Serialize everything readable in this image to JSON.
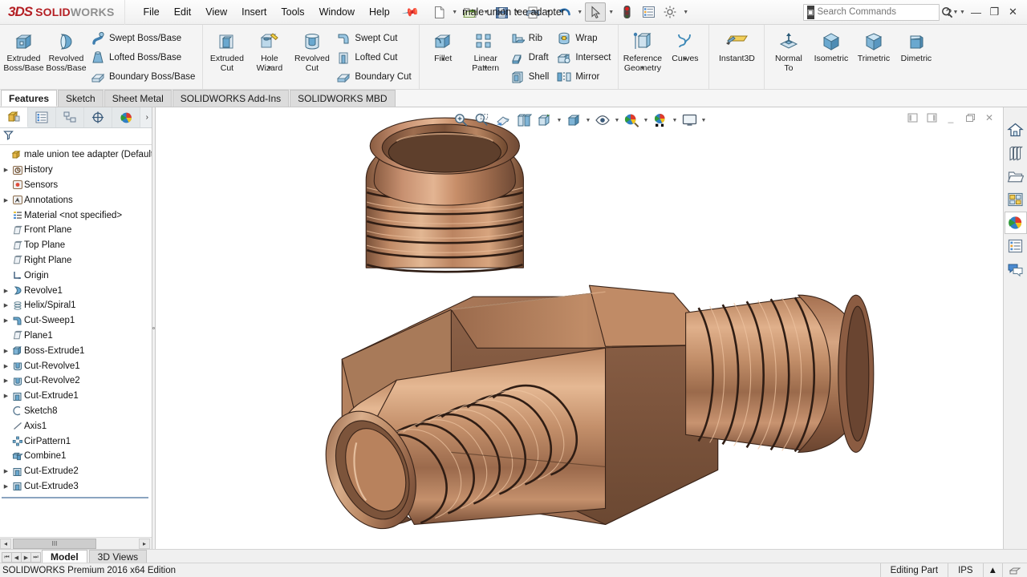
{
  "app": {
    "brand_ds": "3DS",
    "brand_bold": "SOLID",
    "brand_light": "WORKS",
    "document_title": "male union tee adapter",
    "status_edition": "SOLIDWORKS Premium 2016 x64 Edition",
    "status_mode": "Editing Part",
    "status_units": "IPS"
  },
  "menubar": {
    "items": [
      {
        "label": "File"
      },
      {
        "label": "Edit"
      },
      {
        "label": "View"
      },
      {
        "label": "Insert"
      },
      {
        "label": "Tools"
      },
      {
        "label": "Window"
      },
      {
        "label": "Help"
      }
    ],
    "pin_icon": "pushpin-icon"
  },
  "quick_access": {
    "buttons": [
      {
        "name": "new-document-button",
        "icon": "new-file-icon",
        "has_caret": true
      },
      {
        "name": "open-document-button",
        "icon": "open-folder-icon",
        "has_caret": true
      },
      {
        "name": "save-button",
        "icon": "save-floppy-icon",
        "has_caret": true
      },
      {
        "name": "print-button",
        "icon": "printer-icon",
        "has_caret": true
      },
      {
        "name": "undo-button",
        "icon": "undo-arrow-icon",
        "has_caret": true
      },
      {
        "name": "select-button",
        "icon": "cursor-arrow-icon",
        "has_caret": true,
        "selected": true
      },
      {
        "name": "rebuild-button",
        "icon": "traffic-light-icon",
        "has_caret": false
      },
      {
        "name": "options-button",
        "icon": "options-list-icon",
        "has_caret": false
      },
      {
        "name": "settings-button",
        "icon": "gear-icon",
        "has_caret": true
      }
    ]
  },
  "search": {
    "placeholder": "Search Commands",
    "icon": "solidworks-search-icon",
    "magnifier_icon": "magnifier-icon"
  },
  "window_controls": {
    "help": "?",
    "minimize": "—",
    "restore": "❐",
    "close": "✕"
  },
  "ribbon": {
    "groups": [
      {
        "name": "boss-base-group",
        "big": [
          {
            "label": "Extruded\nBoss/Base",
            "icon": "extruded-boss-icon",
            "dropdown": false
          },
          {
            "label": "Revolved\nBoss/Base",
            "icon": "revolved-boss-icon",
            "dropdown": false
          }
        ],
        "small": [
          {
            "label": "Swept Boss/Base",
            "icon": "swept-boss-icon"
          },
          {
            "label": "Lofted Boss/Base",
            "icon": "lofted-boss-icon"
          },
          {
            "label": "Boundary Boss/Base",
            "icon": "boundary-boss-icon"
          }
        ]
      },
      {
        "name": "cut-group",
        "big": [
          {
            "label": "Extruded\nCut",
            "icon": "extruded-cut-icon",
            "dropdown": false
          },
          {
            "label": "Hole\nWizard",
            "icon": "hole-wizard-icon",
            "dropdown": true
          },
          {
            "label": "Revolved\nCut",
            "icon": "revolved-cut-icon",
            "dropdown": false
          }
        ],
        "small": [
          {
            "label": "Swept Cut",
            "icon": "swept-cut-icon"
          },
          {
            "label": "Lofted Cut",
            "icon": "lofted-cut-icon"
          },
          {
            "label": "Boundary Cut",
            "icon": "boundary-cut-icon"
          }
        ]
      },
      {
        "name": "feature-group",
        "big": [
          {
            "label": "Fillet",
            "icon": "fillet-icon",
            "dropdown": true
          },
          {
            "label": "Linear\nPattern",
            "icon": "linear-pattern-icon",
            "dropdown": true
          }
        ],
        "small": [
          {
            "label": "Rib",
            "icon": "rib-icon"
          },
          {
            "label": "Draft",
            "icon": "draft-icon"
          },
          {
            "label": "Shell",
            "icon": "shell-icon"
          }
        ],
        "small2": [
          {
            "label": "Wrap",
            "icon": "wrap-icon"
          },
          {
            "label": "Intersect",
            "icon": "intersect-icon"
          },
          {
            "label": "Mirror",
            "icon": "mirror-icon"
          }
        ]
      },
      {
        "name": "reference-group",
        "big": [
          {
            "label": "Reference\nGeometry",
            "icon": "reference-geometry-icon",
            "dropdown": true
          },
          {
            "label": "Curves",
            "icon": "curves-icon",
            "dropdown": true
          }
        ]
      },
      {
        "name": "instant3d-group",
        "big": [
          {
            "label": "Instant3D",
            "icon": "instant3d-icon",
            "dropdown": false
          }
        ]
      },
      {
        "name": "view-orientation-group",
        "big": [
          {
            "label": "Normal\nTo",
            "icon": "normal-to-icon",
            "dropdown": false
          },
          {
            "label": "Isometric",
            "icon": "isometric-cube-icon",
            "dropdown": false
          },
          {
            "label": "Trimetric",
            "icon": "trimetric-cube-icon",
            "dropdown": false
          },
          {
            "label": "Dimetric",
            "icon": "dimetric-cube-icon",
            "dropdown": false
          }
        ]
      }
    ]
  },
  "command_tabs": [
    {
      "label": "Features",
      "active": true
    },
    {
      "label": "Sketch",
      "active": false
    },
    {
      "label": "Sheet Metal",
      "active": false
    },
    {
      "label": "SOLIDWORKS Add-Ins",
      "active": false
    },
    {
      "label": "SOLIDWORKS MBD",
      "active": false
    }
  ],
  "feature_manager": {
    "tabs": [
      {
        "name": "feature-manager-tab",
        "icon": "feature-tree-icon",
        "active": true
      },
      {
        "name": "property-manager-tab",
        "icon": "property-list-icon",
        "active": false
      },
      {
        "name": "configuration-manager-tab",
        "icon": "configuration-icon",
        "active": false
      },
      {
        "name": "dimxpert-manager-tab",
        "icon": "dimxpert-target-icon",
        "active": false
      },
      {
        "name": "display-manager-tab",
        "icon": "display-sphere-icon",
        "active": false
      }
    ],
    "more_icon": "chevron-right-icon",
    "filter_icon": "filter-funnel-icon",
    "root": {
      "label": "male union tee adapter  (Default<",
      "icon": "part-icon"
    },
    "items": [
      {
        "label": "History",
        "icon": "history-icon",
        "expandable": true
      },
      {
        "label": "Sensors",
        "icon": "sensors-icon",
        "expandable": false
      },
      {
        "label": "Annotations",
        "icon": "annotations-icon",
        "expandable": true
      },
      {
        "label": "Material <not specified>",
        "icon": "material-icon",
        "expandable": false
      },
      {
        "label": "Front Plane",
        "icon": "plane-icon",
        "expandable": false
      },
      {
        "label": "Top Plane",
        "icon": "plane-icon",
        "expandable": false
      },
      {
        "label": "Right Plane",
        "icon": "plane-icon",
        "expandable": false
      },
      {
        "label": "Origin",
        "icon": "origin-icon",
        "expandable": false
      },
      {
        "label": "Revolve1",
        "icon": "revolve-feature-icon",
        "expandable": true
      },
      {
        "label": "Helix/Spiral1",
        "icon": "helix-icon",
        "expandable": true
      },
      {
        "label": "Cut-Sweep1",
        "icon": "cut-sweep-icon",
        "expandable": true
      },
      {
        "label": "Plane1",
        "icon": "plane-icon",
        "expandable": false
      },
      {
        "label": "Boss-Extrude1",
        "icon": "boss-extrude-icon",
        "expandable": true
      },
      {
        "label": "Cut-Revolve1",
        "icon": "cut-revolve-icon",
        "expandable": true
      },
      {
        "label": "Cut-Revolve2",
        "icon": "cut-revolve-icon",
        "expandable": true
      },
      {
        "label": "Cut-Extrude1",
        "icon": "cut-extrude-icon",
        "expandable": true
      },
      {
        "label": "Sketch8",
        "icon": "sketch-icon",
        "expandable": false
      },
      {
        "label": "Axis1",
        "icon": "axis-icon",
        "expandable": false
      },
      {
        "label": "CirPattern1",
        "icon": "circular-pattern-icon",
        "expandable": false
      },
      {
        "label": "Combine1",
        "icon": "combine-icon",
        "expandable": false
      },
      {
        "label": "Cut-Extrude2",
        "icon": "cut-extrude-icon",
        "expandable": true
      },
      {
        "label": "Cut-Extrude3",
        "icon": "cut-extrude-icon",
        "expandable": true
      }
    ],
    "scroll": {
      "left_arrow": "◂",
      "right_arrow": "▸",
      "grip": "III"
    }
  },
  "heads_up_view": {
    "buttons": [
      {
        "name": "zoom-to-fit-button",
        "icon": "zoom-to-fit-icon",
        "caret": false
      },
      {
        "name": "zoom-to-area-button",
        "icon": "zoom-to-area-icon",
        "caret": false
      },
      {
        "name": "previous-view-button",
        "icon": "previous-view-icon",
        "caret": false
      },
      {
        "name": "section-view-button",
        "icon": "section-view-icon",
        "caret": false
      },
      {
        "name": "view-orientation-button",
        "icon": "view-orientation-icon",
        "caret": true
      },
      {
        "name": "display-style-button",
        "icon": "display-style-icon",
        "caret": true
      },
      {
        "name": "hide-show-items-button",
        "icon": "hide-show-eye-icon",
        "caret": true
      },
      {
        "name": "edit-appearance-button",
        "icon": "edit-appearance-icon",
        "caret": true
      },
      {
        "name": "apply-scene-button",
        "icon": "apply-scene-icon",
        "caret": true
      },
      {
        "name": "view-settings-button",
        "icon": "view-settings-monitor-icon",
        "caret": true
      }
    ]
  },
  "document_window_controls": [
    {
      "name": "doc-restore-left-button",
      "icon": "panel-left-icon"
    },
    {
      "name": "doc-restore-right-button",
      "icon": "panel-right-icon"
    },
    {
      "name": "doc-minimize-button",
      "icon": "minimize-icon"
    },
    {
      "name": "doc-restore-button",
      "icon": "restore-icon"
    },
    {
      "name": "doc-close-button",
      "icon": "close-icon"
    }
  ],
  "task_pane": [
    {
      "name": "task-pane-home",
      "icon": "home-icon",
      "active": false
    },
    {
      "name": "task-pane-design-library",
      "icon": "design-library-icon",
      "active": false
    },
    {
      "name": "task-pane-file-explorer",
      "icon": "folder-icon",
      "active": false
    },
    {
      "name": "task-pane-view-palette",
      "icon": "view-palette-icon",
      "active": false
    },
    {
      "name": "task-pane-appearances",
      "icon": "appearances-sphere-icon",
      "active": true
    },
    {
      "name": "task-pane-custom-properties",
      "icon": "custom-properties-icon",
      "active": false
    },
    {
      "name": "task-pane-forum",
      "icon": "forum-chat-icon",
      "active": false
    }
  ],
  "document_tabs": [
    {
      "label": "Model",
      "active": true
    },
    {
      "label": "3D Views",
      "active": false
    }
  ],
  "model": {
    "name": "male-union-tee-adapter-3d-model",
    "description": "Copper JIC male union tee adapter with three flared threaded ports and a hexagonal center body",
    "colors": {
      "copper_highlight": "#e0a77f",
      "copper_light": "#c98a62",
      "copper_mid": "#a8704f",
      "copper_dark": "#7a5138",
      "copper_shadow": "#5d3d2b",
      "edge": "#3a2419",
      "background": "#ffffff"
    }
  }
}
